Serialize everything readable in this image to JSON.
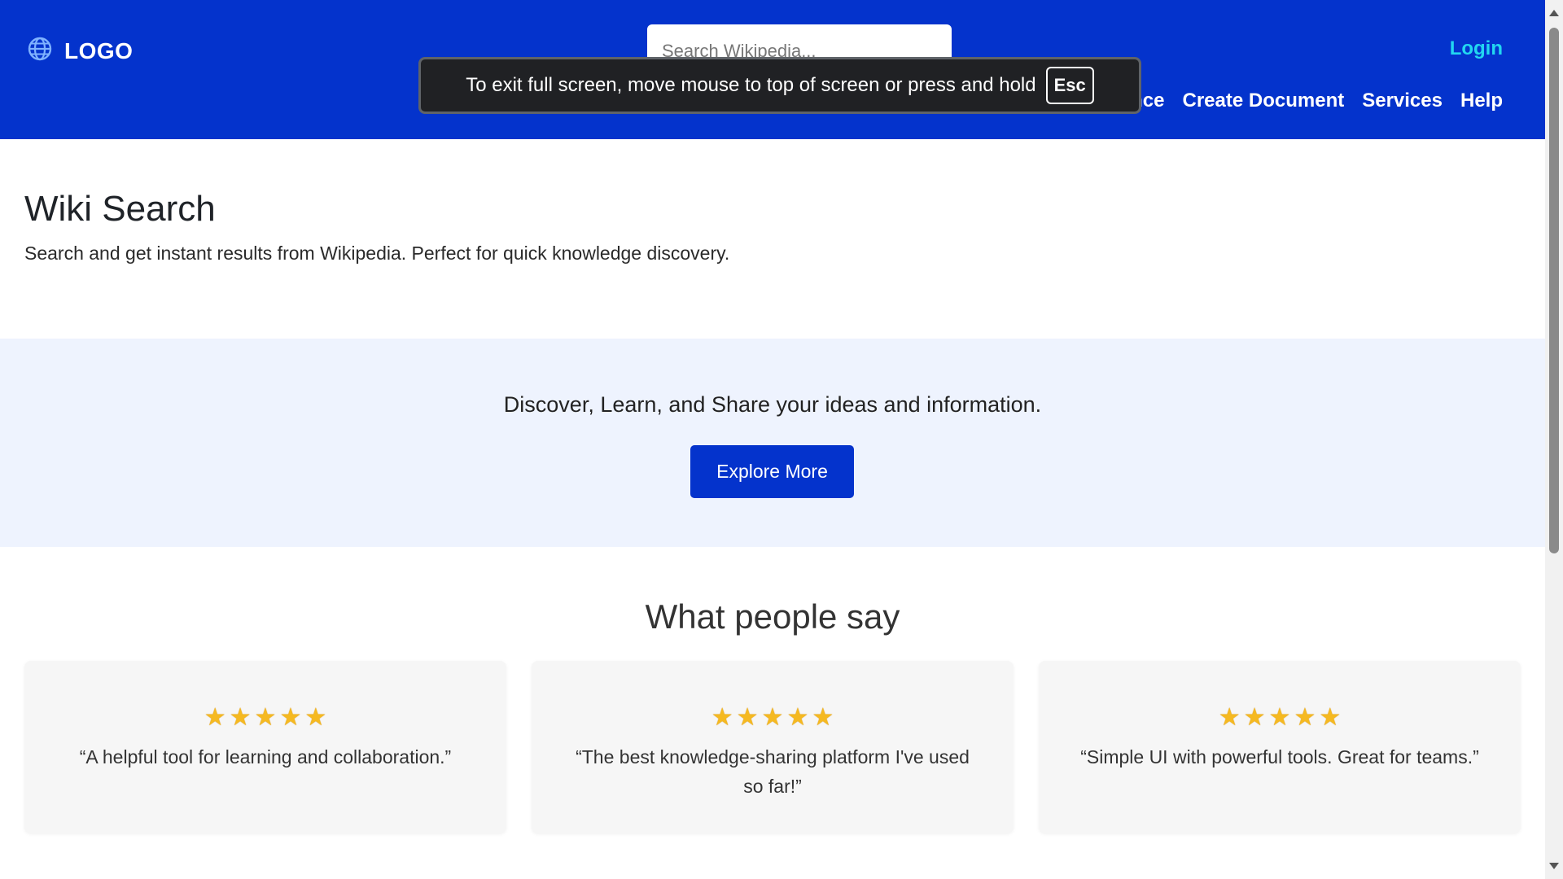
{
  "header": {
    "logo_text": "LOGO",
    "logo_icon": "globe-icon",
    "search_placeholder": "Search Wikipedia...",
    "login_label": "Login",
    "login_color": "#22d7f0",
    "bg_color": "#0433cc",
    "nav_items": [
      {
        "label": "rience"
      },
      {
        "label": "Create Document"
      },
      {
        "label": "Services"
      },
      {
        "label": "Help"
      }
    ]
  },
  "fullscreen_toast": {
    "text": "To exit full screen, move mouse to top of screen or press and hold",
    "key": "Esc"
  },
  "intro": {
    "title": "Wiki Search",
    "text": "Search and get instant results from Wikipedia. Perfect for quick knowledge discovery."
  },
  "banner": {
    "text": "Discover, Learn, and Share your ideas and information.",
    "button_label": "Explore More",
    "bg_color": "#eef3fe"
  },
  "testimonials": {
    "title": "What people say",
    "cards": [
      {
        "rating": 5,
        "quote": "“A helpful tool for learning and collaboration.”"
      },
      {
        "rating": 5,
        "quote": "“The best knowledge-sharing platform I've used so far!”"
      },
      {
        "rating": 5,
        "quote": "“Simple UI with powerful tools. Great for teams.”"
      }
    ]
  }
}
